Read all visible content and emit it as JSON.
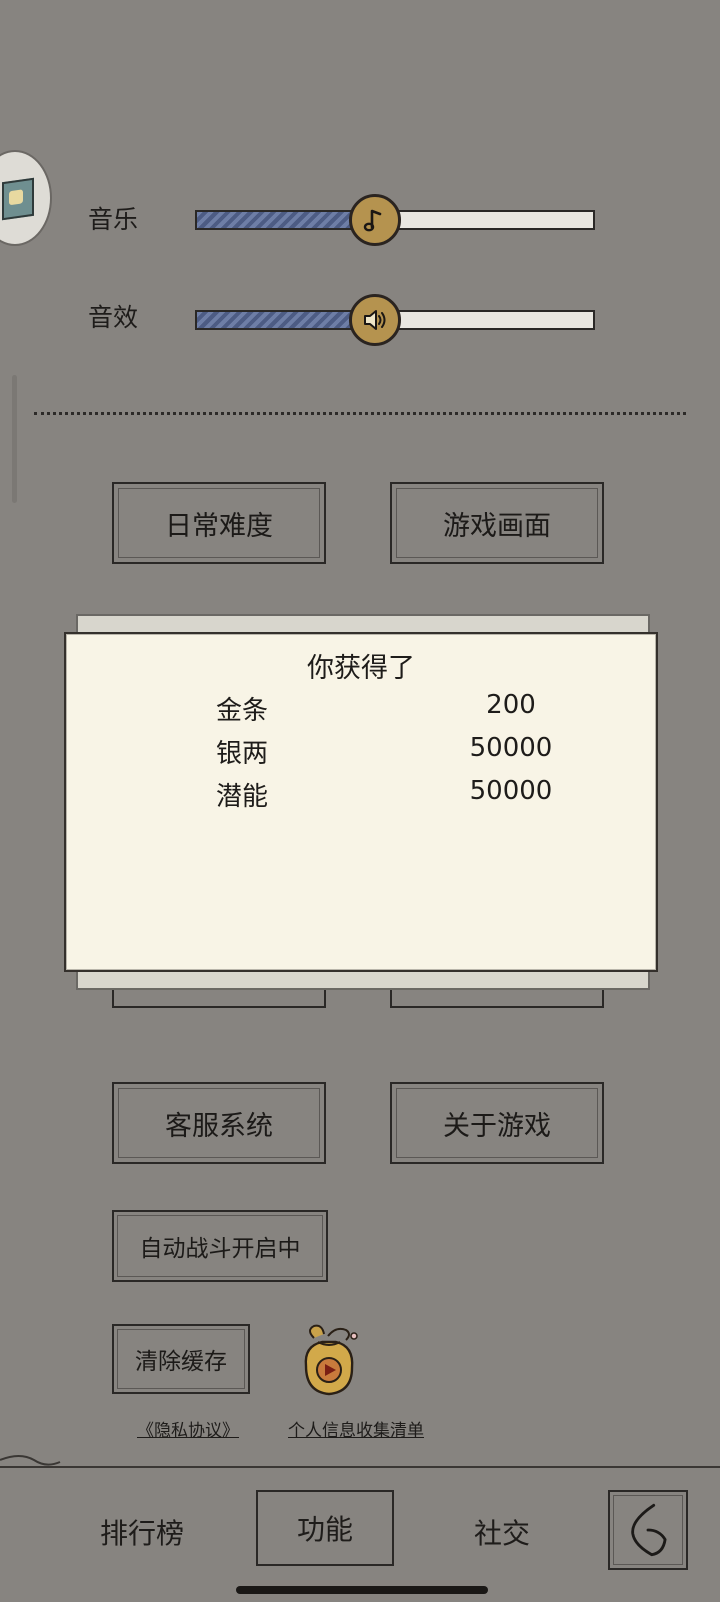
{
  "settings": {
    "music_label": "音乐",
    "sfx_label": "音效",
    "music_level": 0.45,
    "sfx_level": 0.45,
    "music_icon": "music-note-icon",
    "sfx_icon": "speaker-icon"
  },
  "menu": {
    "daily_difficulty": "日常难度",
    "game_display": "游戏画面",
    "customer_service": "客服系统",
    "about_game": "关于游戏",
    "auto_battle": "自动战斗开启中",
    "clear_cache": "清除缓存",
    "privacy_link": "《隐私协议》",
    "info_list_link": "个人信息收集清单"
  },
  "popup": {
    "title": "你获得了",
    "rewards": [
      {
        "name": "金条",
        "value": "200"
      },
      {
        "name": "银两",
        "value": "50000"
      },
      {
        "name": "潜能",
        "value": "50000"
      }
    ]
  },
  "nav": {
    "ranking": "排行榜",
    "functions": "功能",
    "social": "社交",
    "active": "功能"
  },
  "colors": {
    "background": "#878480",
    "popup_bg": "#f8f4e6",
    "slider_fill": "#5d6d95",
    "knob": "#b5934f"
  }
}
